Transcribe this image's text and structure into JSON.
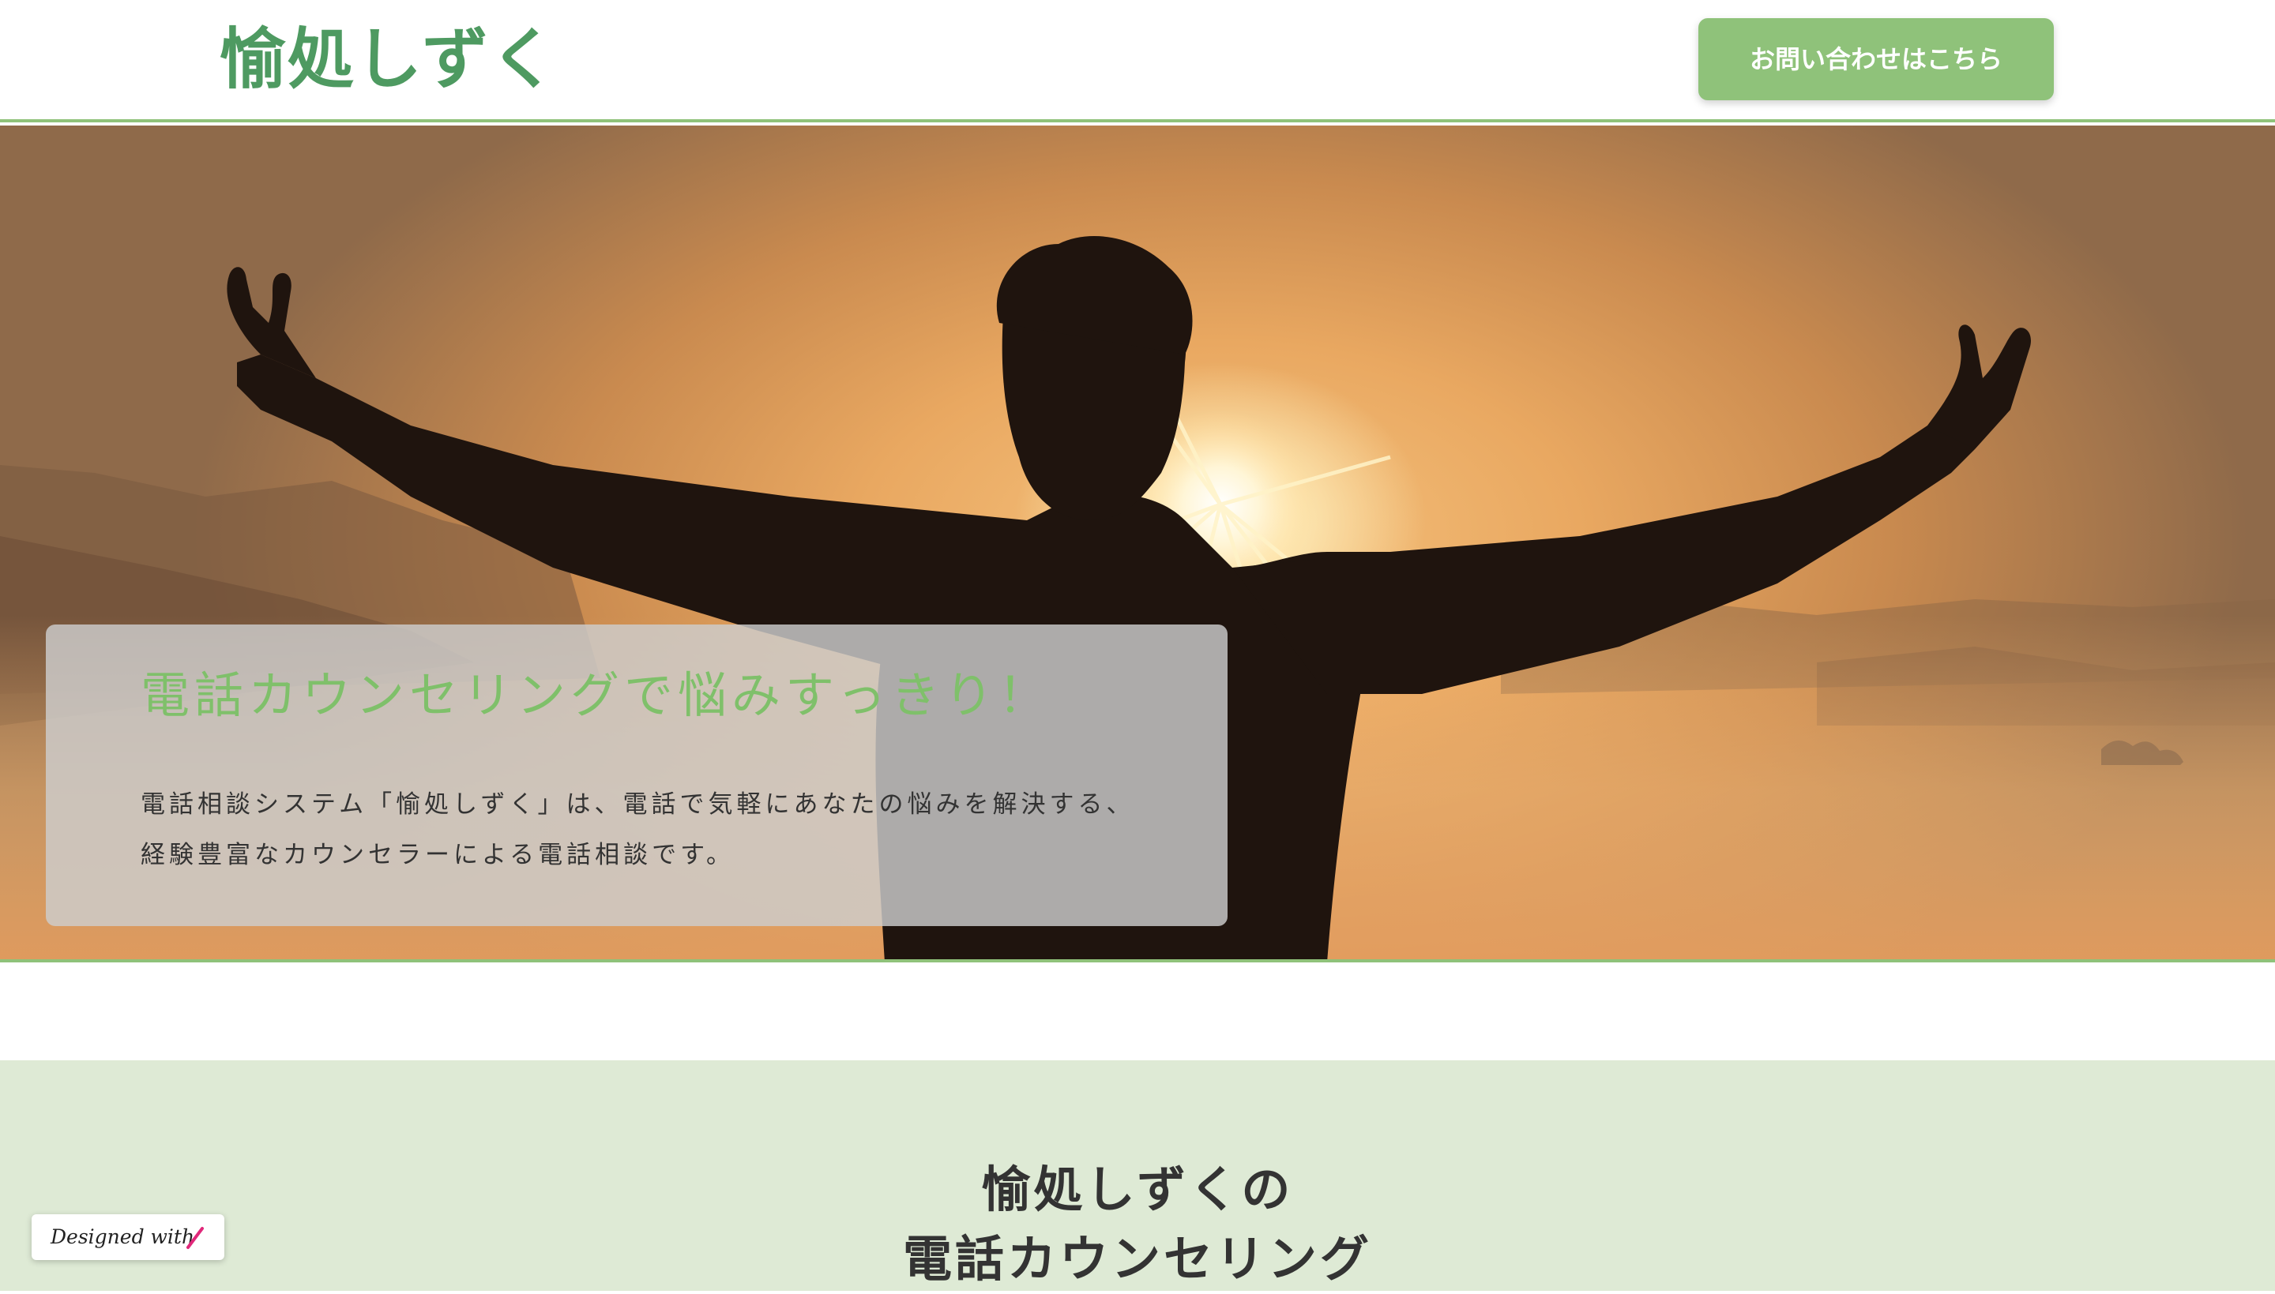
{
  "header": {
    "logo_text": "愉処しずく",
    "contact_button_label": "お問い合わせはこちら"
  },
  "hero": {
    "title": "電話カウンセリングで悩みすっきり！",
    "description_lines": [
      "電話相談システム「愉処しずく」は、電話で気軽にあなたの悩みを解決する、",
      "経験豊富なカウンセラーによる電話相談です。"
    ]
  },
  "section": {
    "title_lines": [
      "愉処しずくの",
      "電話カウンセリング"
    ]
  },
  "badge": {
    "text": "Designed with"
  },
  "colors": {
    "brand_green": "#4e9a61",
    "accent_green": "#8fc27a",
    "hero_title_green": "#7fc06a",
    "section_bg": "#deead5",
    "badge_mark": "#e0287a"
  },
  "icons": {
    "badge_mark": "brand-slash-icon"
  }
}
